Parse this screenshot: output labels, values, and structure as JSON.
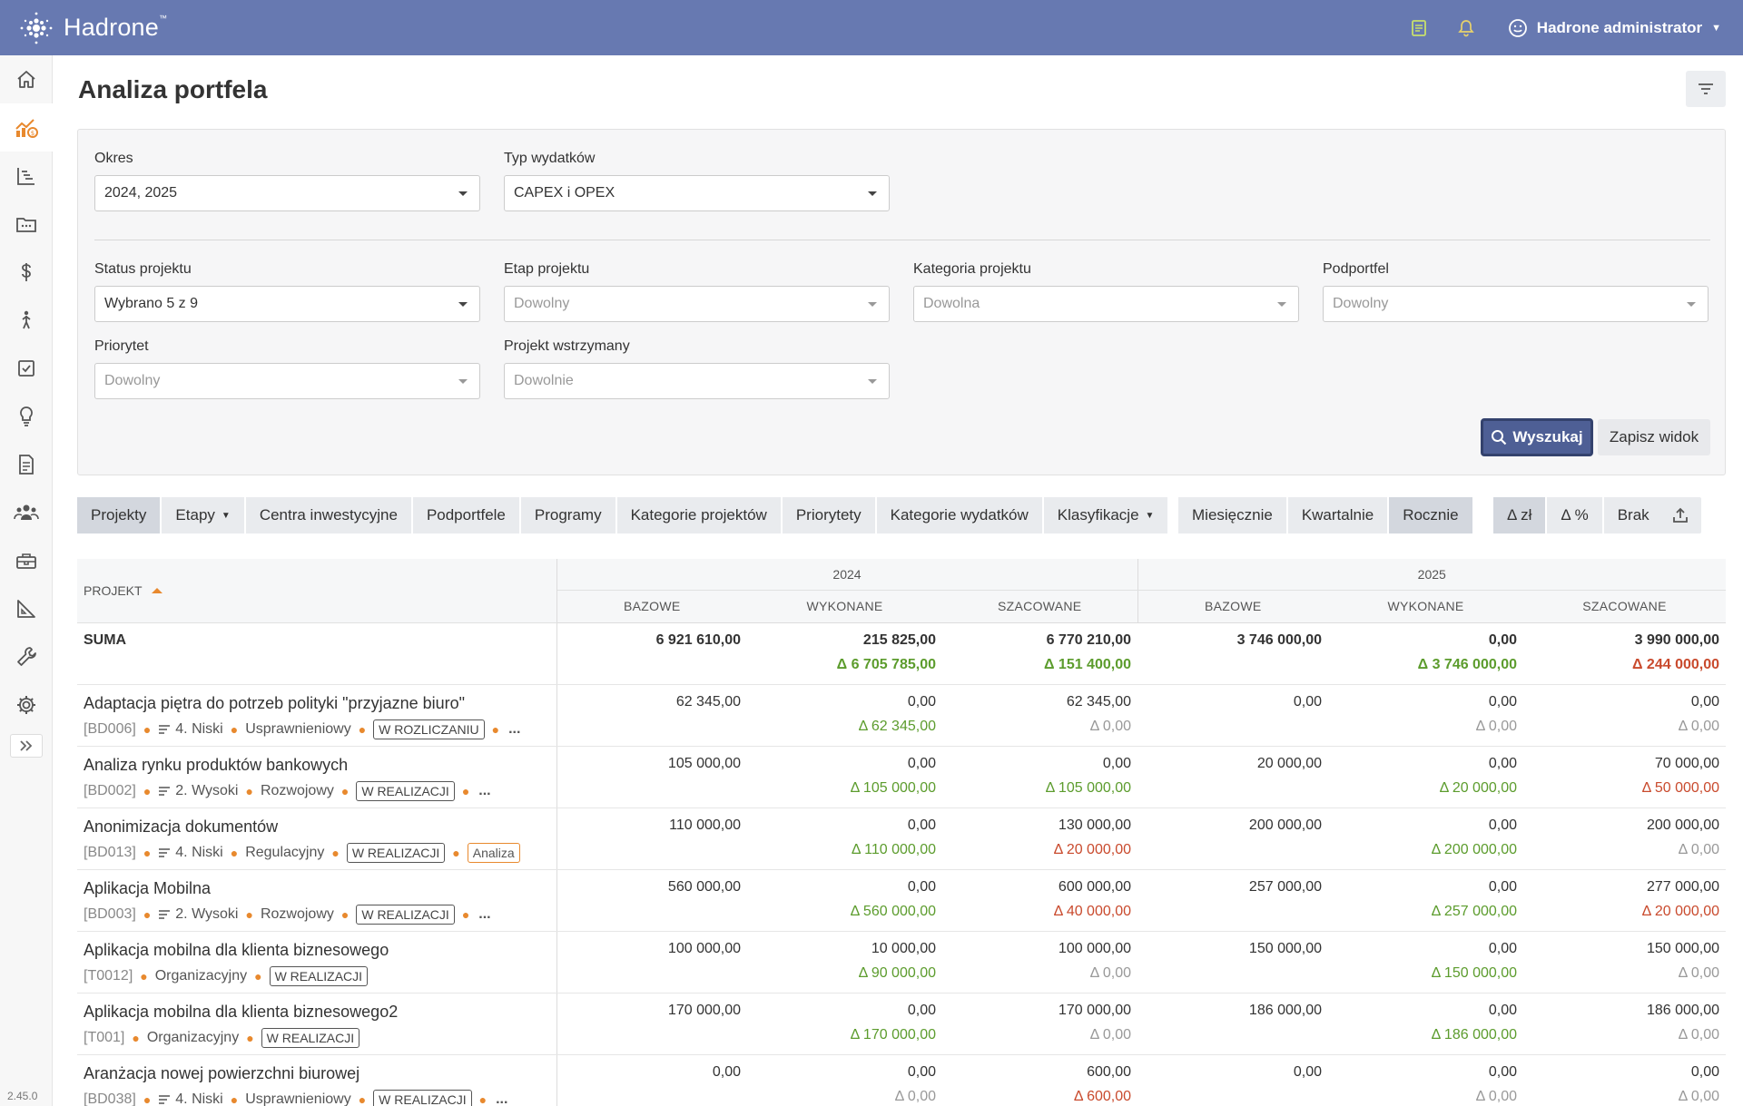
{
  "app": {
    "name": "Hadrone",
    "version": "2.45.0"
  },
  "header": {
    "user": "Hadrone administrator"
  },
  "sidebar": {
    "items": [
      "home-icon",
      "portfolio-analysis-icon",
      "timeline-chart-icon",
      "folder-icon",
      "dollar-icon",
      "person-walking-icon",
      "checkbox-icon",
      "lightbulb-icon",
      "document-icon",
      "team-icon",
      "toolbox-icon",
      "triangle-ruler-icon",
      "wrench-icon",
      "gear-icon"
    ]
  },
  "page": {
    "title": "Analiza portfela"
  },
  "filters": {
    "okres": {
      "label": "Okres",
      "value": "2024, 2025"
    },
    "typ": {
      "label": "Typ wydatków",
      "value": "CAPEX i OPEX"
    },
    "status": {
      "label": "Status projektu",
      "value": "Wybrano 5 z 9"
    },
    "etap": {
      "label": "Etap projektu",
      "placeholder": "Dowolny"
    },
    "kategoria": {
      "label": "Kategoria projektu",
      "placeholder": "Dowolna"
    },
    "podportfel": {
      "label": "Podportfel",
      "placeholder": "Dowolny"
    },
    "priorytet": {
      "label": "Priorytet",
      "placeholder": "Dowolny"
    },
    "wstrzymany": {
      "label": "Projekt wstrzymany",
      "placeholder": "Dowolnie"
    },
    "search_label": "Wyszukaj",
    "save_view_label": "Zapisz widok"
  },
  "group_tabs": [
    "Projekty",
    "Etapy",
    "Centra inwestycyjne",
    "Podportfele",
    "Programy",
    "Kategorie projektów",
    "Priorytety",
    "Kategorie wydatków",
    "Klasyfikacje"
  ],
  "period_tabs": [
    "Miesięcznie",
    "Kwartalnie",
    "Rocznie"
  ],
  "delta_tabs": [
    "Δ zł",
    "Δ %",
    "Brak"
  ],
  "table": {
    "project_header": "PROJEKT",
    "years": [
      "2024",
      "2025"
    ],
    "subcols": [
      "BAZOWE",
      "WYKONANE",
      "SZACOWANE"
    ],
    "sum": {
      "name": "SUMA",
      "values": [
        "6 921 610,00",
        "215 825,00",
        "6 770 210,00",
        "3 746 000,00",
        "0,00",
        "3 990 000,00"
      ],
      "deltas": [
        null,
        {
          "t": "Δ 6 705 785,00",
          "s": "pos"
        },
        {
          "t": "Δ 151 400,00",
          "s": "pos"
        },
        null,
        {
          "t": "Δ 3 746 000,00",
          "s": "pos"
        },
        {
          "t": "Δ 244 000,00",
          "s": "neg"
        }
      ]
    },
    "rows": [
      {
        "name": "Adaptacja piętra do potrzeb polityki \"przyjazne biuro\"",
        "code": "[BD006]",
        "priority": "4. Niski",
        "category": "Usprawnieniowy",
        "status": "W ROZLICZANIU",
        "extra": "...",
        "values": [
          "62 345,00",
          "0,00",
          "62 345,00",
          "0,00",
          "0,00",
          "0,00"
        ],
        "deltas": [
          null,
          {
            "t": "Δ 62 345,00",
            "s": "pos"
          },
          {
            "t": "Δ 0,00",
            "s": "zero"
          },
          null,
          {
            "t": "Δ 0,00",
            "s": "zero"
          },
          {
            "t": "Δ 0,00",
            "s": "zero"
          }
        ]
      },
      {
        "name": "Analiza rynku produktów bankowych",
        "code": "[BD002]",
        "priority": "2. Wysoki",
        "category": "Rozwojowy",
        "status": "W REALIZACJI",
        "extra": "...",
        "values": [
          "105 000,00",
          "0,00",
          "0,00",
          "20 000,00",
          "0,00",
          "70 000,00"
        ],
        "deltas": [
          null,
          {
            "t": "Δ 105 000,00",
            "s": "pos"
          },
          {
            "t": "Δ 105 000,00",
            "s": "pos"
          },
          null,
          {
            "t": "Δ 20 000,00",
            "s": "pos"
          },
          {
            "t": "Δ 50 000,00",
            "s": "neg"
          }
        ]
      },
      {
        "name": "Anonimizacja dokumentów",
        "code": "[BD013]",
        "priority": "4. Niski",
        "category": "Regulacyjny",
        "status": "W REALIZACJI",
        "tag": "Analiza",
        "values": [
          "110 000,00",
          "0,00",
          "130 000,00",
          "200 000,00",
          "0,00",
          "200 000,00"
        ],
        "deltas": [
          null,
          {
            "t": "Δ 110 000,00",
            "s": "pos"
          },
          {
            "t": "Δ 20 000,00",
            "s": "neg"
          },
          null,
          {
            "t": "Δ 200 000,00",
            "s": "pos"
          },
          {
            "t": "Δ 0,00",
            "s": "zero"
          }
        ]
      },
      {
        "name": "Aplikacja Mobilna",
        "code": "[BD003]",
        "priority": "2. Wysoki",
        "category": "Rozwojowy",
        "status": "W REALIZACJI",
        "extra": "...",
        "values": [
          "560 000,00",
          "0,00",
          "600 000,00",
          "257 000,00",
          "0,00",
          "277 000,00"
        ],
        "deltas": [
          null,
          {
            "t": "Δ 560 000,00",
            "s": "pos"
          },
          {
            "t": "Δ 40 000,00",
            "s": "neg"
          },
          null,
          {
            "t": "Δ 257 000,00",
            "s": "pos"
          },
          {
            "t": "Δ 20 000,00",
            "s": "neg"
          }
        ]
      },
      {
        "name": "Aplikacja mobilna dla klienta biznesowego",
        "code": "[T0012]",
        "category": "Organizacyjny",
        "status": "W REALIZACJI",
        "values": [
          "100 000,00",
          "10 000,00",
          "100 000,00",
          "150 000,00",
          "0,00",
          "150 000,00"
        ],
        "deltas": [
          null,
          {
            "t": "Δ 90 000,00",
            "s": "pos"
          },
          {
            "t": "Δ 0,00",
            "s": "zero"
          },
          null,
          {
            "t": "Δ 150 000,00",
            "s": "pos"
          },
          {
            "t": "Δ 0,00",
            "s": "zero"
          }
        ]
      },
      {
        "name": "Aplikacja mobilna dla klienta biznesowego2",
        "code": "[T001]",
        "category": "Organizacyjny",
        "status": "W REALIZACJI",
        "values": [
          "170 000,00",
          "0,00",
          "170 000,00",
          "186 000,00",
          "0,00",
          "186 000,00"
        ],
        "deltas": [
          null,
          {
            "t": "Δ 170 000,00",
            "s": "pos"
          },
          {
            "t": "Δ 0,00",
            "s": "zero"
          },
          null,
          {
            "t": "Δ 186 000,00",
            "s": "pos"
          },
          {
            "t": "Δ 0,00",
            "s": "zero"
          }
        ]
      },
      {
        "name": "Aranżacja nowej powierzchni biurowej",
        "code": "[BD038]",
        "priority": "4. Niski",
        "category": "Usprawnieniowy",
        "status": "W REALIZACJI",
        "extra": "...",
        "values": [
          "0,00",
          "0,00",
          "600,00",
          "0,00",
          "0,00",
          "0,00"
        ],
        "deltas": [
          null,
          {
            "t": "Δ 0,00",
            "s": "zero"
          },
          {
            "t": "Δ 600,00",
            "s": "neg"
          },
          null,
          {
            "t": "Δ 0,00",
            "s": "zero"
          },
          {
            "t": "Δ 0,00",
            "s": "zero"
          }
        ]
      }
    ]
  }
}
